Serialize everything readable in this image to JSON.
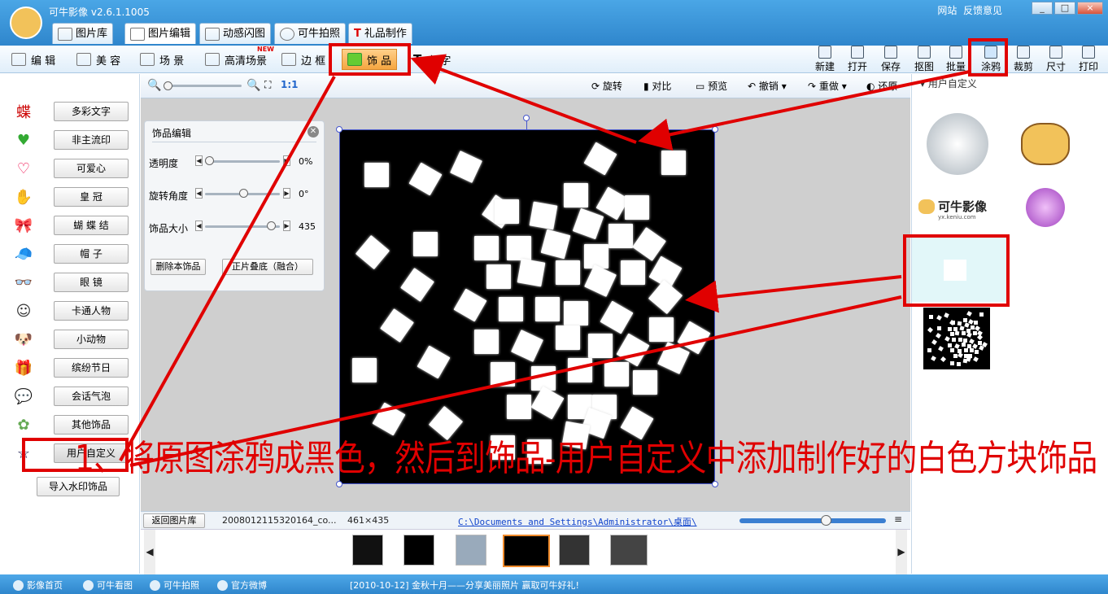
{
  "app": {
    "title": "可牛影像",
    "version": "v2.6.1.1005",
    "links": [
      "网站",
      "反馈意见"
    ],
    "window_buttons": [
      "_",
      "□",
      "×"
    ]
  },
  "main_tabs": [
    "图片库",
    "图片编辑",
    "动感闪图",
    "可牛拍照",
    "礼品制作"
  ],
  "main_tab_active": "图片编辑",
  "edit_tabs": [
    "编 辑",
    "美 容",
    "场 景",
    "高清场景",
    "边 框",
    "饰 品",
    "文 字"
  ],
  "new_badge": "NEW",
  "right_tools": [
    "新建",
    "打开",
    "保存",
    "抠图",
    "批量",
    "涂鸦",
    "裁剪",
    "尺寸",
    "打印"
  ],
  "ctrl": {
    "zoom_label": "1:1",
    "rotate": "旋转",
    "compare": "对比",
    "preview": "预览",
    "undo": "撤销",
    "redo": "重做",
    "restore": "还原"
  },
  "categories": [
    "多彩文字",
    "非主流印",
    "可爱心",
    "皇 冠",
    "蝴 蝶 结",
    "帽 子",
    "眼 镜",
    "卡通人物",
    "小动物",
    "缤纷节日",
    "会话气泡",
    "其他饰品",
    "用户自定义"
  ],
  "category_icons": [
    "蝶",
    "♥",
    "♡",
    "✋",
    "🎀",
    "🧢",
    "👓",
    "☺",
    "🐶",
    "🎁",
    "💬",
    "✿",
    "☆"
  ],
  "import_button": "导入水印饰品",
  "panel": {
    "title": "饰品编辑",
    "opacity_label": "透明度",
    "opacity_value": "0%",
    "opacity_level": 0,
    "rotate_label": "旋转角度",
    "rotate_value": "0°",
    "rotate_level": 0.5,
    "size_label": "饰品大小",
    "size_value": "435",
    "size_level": 0.9,
    "delete_btn": "删除本饰品",
    "merge_btn": "正片叠底（融合）"
  },
  "status": {
    "back_btn": "返回图片库",
    "filename": "2008012115320164_co...",
    "dims": "461×435",
    "path": "C:\\Documents and Settings\\Administrator\\桌面\\"
  },
  "right_panel": {
    "header": "用户自定义",
    "logo_text": "可牛影像",
    "logo_url": "yx.keniu.com"
  },
  "bottom": {
    "items": [
      "影像首页",
      "可牛看图",
      "可牛拍照",
      "官方微博"
    ],
    "news": "[2010-10-12] 金秋十月——分享美丽照片 赢取可牛好礼!"
  },
  "caption": "1、将原图涂鸦成黑色，然后到饰品-用户自定义中添加制作好的白色方块饰品",
  "colors": {
    "annotation": "#e00000",
    "titlebar": "#2f86cc"
  }
}
